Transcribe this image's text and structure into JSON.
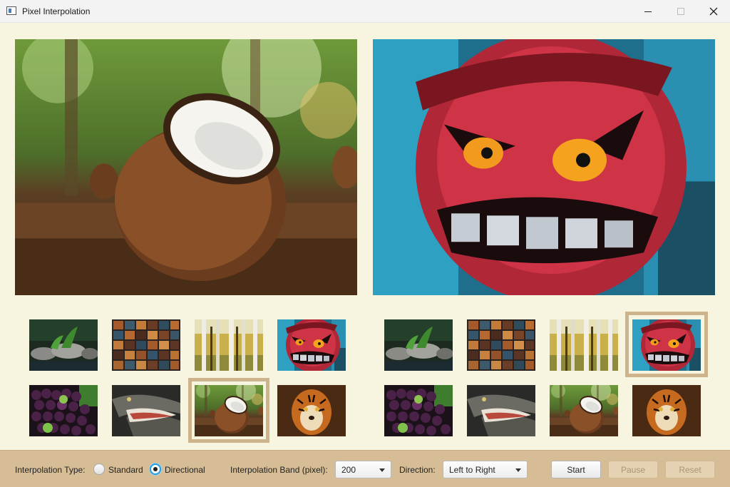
{
  "window": {
    "title": "Pixel Interpolation",
    "minimize_icon": "minimize-icon",
    "maximize_icon": "maximize-icon",
    "close_icon": "close-icon"
  },
  "images": {
    "left_preview": "coconut",
    "right_preview": "graffiti-monster",
    "left_gallery": [
      "garden-stones",
      "wooden-blocks",
      "birch-forest",
      "graffiti-monster",
      "grapes",
      "crocodile",
      "coconut",
      "tiger"
    ],
    "right_gallery": [
      "garden-stones",
      "wooden-blocks",
      "birch-forest",
      "graffiti-monster",
      "grapes",
      "crocodile",
      "coconut",
      "tiger"
    ],
    "left_selected": "coconut",
    "right_selected": "graffiti-monster"
  },
  "toolbar": {
    "interp_type_label": "Interpolation Type:",
    "radio_standard": "Standard",
    "radio_directional": "Directional",
    "selected_type": "Directional",
    "band_label": "Interpolation Band (pixel):",
    "band_value": "200",
    "direction_label": "Direction:",
    "direction_value": "Left to Right",
    "start_label": "Start",
    "pause_label": "Pause",
    "reset_label": "Reset"
  },
  "colors": {
    "background": "#f7f4e0",
    "toolbar": "#d6bd95",
    "selection_frame": "#cdb48c",
    "radio_accent": "#2a9bdc"
  }
}
